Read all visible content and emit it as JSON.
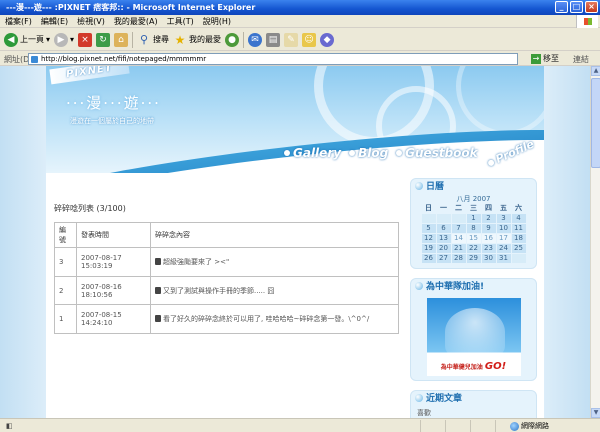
{
  "window": {
    "title": "---漫---遊--- :PIXNET 痞客邦::  - Microsoft Internet Explorer",
    "controls": {
      "minimize": "_",
      "maximize": "□",
      "close": "×"
    }
  },
  "menubar": [
    "檔案(F)",
    "編輯(E)",
    "檢視(V)",
    "我的最愛(A)",
    "工具(T)",
    "說明(H)"
  ],
  "toolbar": {
    "back": "上一頁",
    "search": "搜尋",
    "favorites": "我的最愛"
  },
  "addressbar": {
    "label": "網址(D)",
    "url": "http://blog.pixnet.net/fifi/notepaged/mmmmmr",
    "go": "移至",
    "links": "連結"
  },
  "banner": {
    "logo": "PIXNET",
    "title": "···漫···遊···",
    "subtitle": "漫遊在一個屬於自己的地帶",
    "nav": [
      "Gallery",
      "Blog",
      "Guestbook",
      "Profile"
    ]
  },
  "notes": {
    "title": "碎碎唸列表 (3/100)",
    "columns": [
      "編號",
      "發表時間",
      "碎碎念內容"
    ],
    "rows": [
      {
        "no": "3",
        "date": "2007-08-17",
        "time": "15:03:19",
        "content": "超級強颱要來了 ><\""
      },
      {
        "no": "2",
        "date": "2007-08-16",
        "time": "18:10:56",
        "content": "又到了測試與操作手冊的季節..... 囧"
      },
      {
        "no": "1",
        "date": "2007-08-15",
        "time": "14:24:10",
        "content": "看了好久的碎碎念終於可以用了, 哇哈哈哈~碎碎念第一發。\\^0^/"
      }
    ]
  },
  "sidebar": {
    "calendar": {
      "title": "日曆",
      "month_label": "八月 2007",
      "weekdays": [
        "日",
        "一",
        "二",
        "三",
        "四",
        "五",
        "六"
      ],
      "weeks": [
        [
          "",
          "",
          "",
          "1",
          "2",
          "3",
          "4"
        ],
        [
          "5",
          "6",
          "7",
          "8",
          "9",
          "10",
          "11"
        ],
        [
          "12",
          "13",
          "14",
          "15",
          "16",
          "17",
          "18"
        ],
        [
          "19",
          "20",
          "21",
          "22",
          "23",
          "24",
          "25"
        ],
        [
          "26",
          "27",
          "28",
          "29",
          "30",
          "31",
          ""
        ]
      ]
    },
    "promo": {
      "title": "為中華隊加油!",
      "caption": "為中華健兒加油",
      "go": "GO!"
    },
    "recent": {
      "title": "近期文章",
      "item": "喜歡"
    }
  },
  "statusbar": {
    "zone": "網際網路"
  }
}
